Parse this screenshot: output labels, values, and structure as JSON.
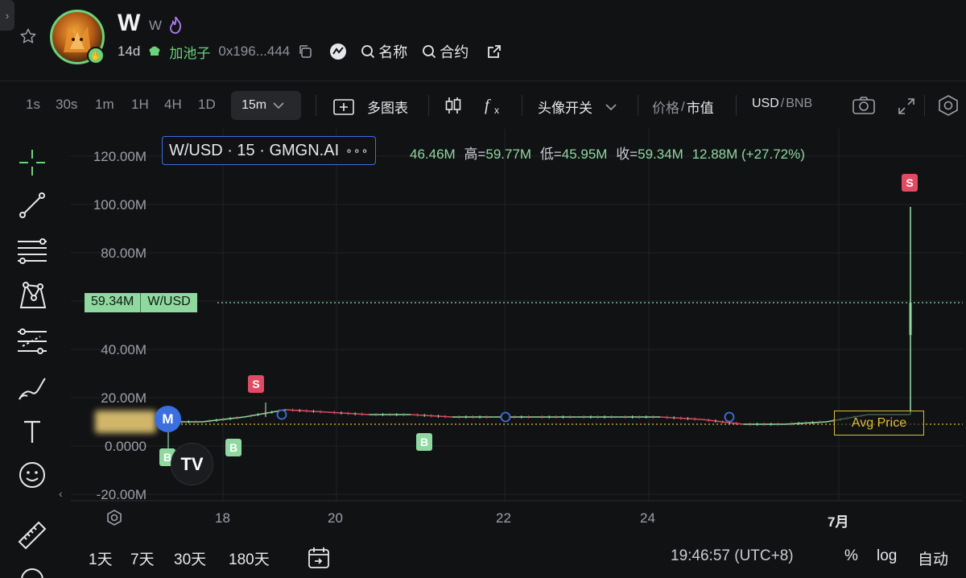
{
  "header": {
    "collapse_glyph": "›",
    "title": "W",
    "symbol": "W",
    "age": "14d",
    "pool_label": "加池子",
    "address": "0x196...444",
    "search_name": "名称",
    "search_contract": "合约"
  },
  "toolbar": {
    "timeframes": [
      "1s",
      "30s",
      "1m",
      "1H",
      "4H",
      "1D"
    ],
    "active_timeframe": "15m",
    "multi_chart": "多图表",
    "avatar_toggle": "头像开关",
    "price_label": "价格",
    "price_sep": "/",
    "mcap_label": "市值",
    "currency_usd": "USD",
    "currency_sep": "/",
    "currency_bnb": "BNB"
  },
  "chart": {
    "legend": "W/USD · 15 · GMGN.AI",
    "legend_more": "∘∘∘",
    "ohlc": {
      "open_value": "46.46M",
      "high_label": "高=",
      "high_value": "59.77M",
      "low_label": "低=",
      "low_value": "45.95M",
      "close_label": "收=",
      "close_value": "59.34M",
      "change": "12.88M (+27.72%)"
    },
    "price_tag_value": "59.34M",
    "price_tag_name": "W/USD",
    "avg_price": "Avg Price",
    "y_labels": [
      "120.00M",
      "100.00M",
      "80.00M",
      "40.00M",
      "20.00M",
      "0.0000",
      "-20.00M"
    ],
    "x_labels": [
      "18",
      "20",
      "22",
      "24",
      "7月"
    ],
    "marker_s": "S",
    "marker_b": "B",
    "marker_m": "M",
    "tv_logo": "TV",
    "colors": {
      "up": "#8fd8a0",
      "down": "#e04a63",
      "accent": "#3b6fe0",
      "avg": "#e0bd3c"
    }
  },
  "bottom": {
    "ranges": [
      "1天",
      "7天",
      "30天",
      "180天"
    ],
    "clock": "19:46:57 (UTC+8)",
    "percent": "%",
    "log": "log",
    "auto": "自动"
  },
  "chart_data": {
    "type": "line",
    "x": [
      "17 08:00",
      "17 16:00",
      "18 00:00",
      "18 08:00",
      "18 12:00",
      "19 00:00",
      "19 12:00",
      "20 00:00",
      "21 00:00",
      "22 00:00",
      "23 00:00",
      "24 00:00",
      "25 00:00",
      "25 12:00",
      "26 00:00",
      "26 12:00",
      "27 00:00",
      "27 12:00",
      "28 00:00"
    ],
    "series": [
      {
        "values": [
          10,
          10,
          12,
          15,
          14,
          13,
          13,
          12,
          12,
          12,
          12,
          12,
          12,
          11,
          9,
          9,
          10,
          13,
          59.34
        ]
      }
    ],
    "ylim": [
      -20,
      125
    ],
    "y_ticks": [
      "120.00M",
      "100.00M",
      "80.00M",
      "40.00M",
      "20.00M",
      "0.0000",
      "-20.00M"
    ],
    "x_ticks": [
      "18",
      "20",
      "22",
      "24",
      "7月"
    ],
    "spike": {
      "high": 99,
      "low": 45.95,
      "close": 59.34
    },
    "avg_price": 9,
    "current_price": 59.34
  }
}
